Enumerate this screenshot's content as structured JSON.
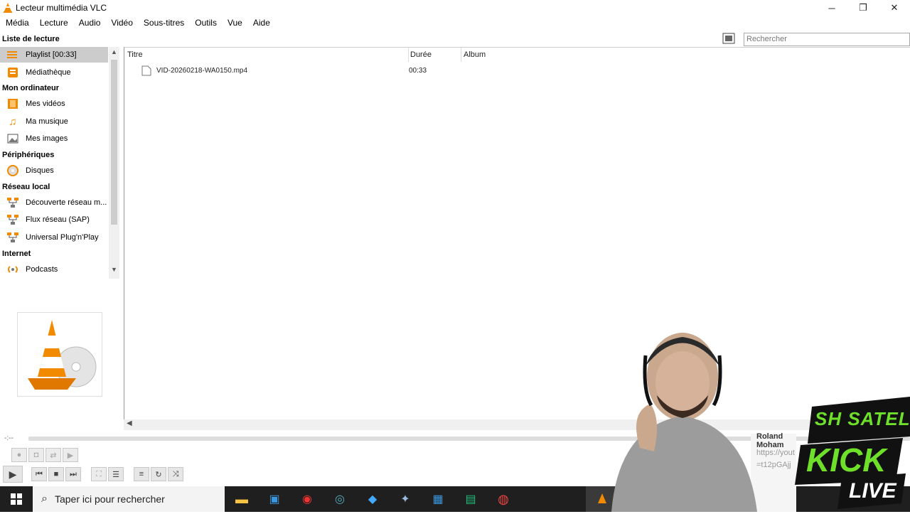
{
  "window": {
    "title": "Lecteur multimédia VLC",
    "minimize": "─",
    "maximize": "❐",
    "close": "✕"
  },
  "menu": [
    "Média",
    "Lecture",
    "Audio",
    "Vidéo",
    "Sous-titres",
    "Outils",
    "Vue",
    "Aide"
  ],
  "sidebar": {
    "sections": [
      {
        "header": "Liste de lecture",
        "items": [
          {
            "label": "Playlist [00:33]",
            "icon": "playlist-icon",
            "selected": true
          },
          {
            "label": "Médiathèque",
            "icon": "library-icon"
          }
        ]
      },
      {
        "header": "Mon ordinateur",
        "items": [
          {
            "label": "Mes vidéos",
            "icon": "videos-icon"
          },
          {
            "label": "Ma musique",
            "icon": "music-icon"
          },
          {
            "label": "Mes images",
            "icon": "images-icon"
          }
        ]
      },
      {
        "header": "Périphériques",
        "items": [
          {
            "label": "Disques",
            "icon": "disc-icon"
          }
        ]
      },
      {
        "header": "Réseau local",
        "items": [
          {
            "label": "Découverte réseau m...",
            "icon": "network-icon"
          },
          {
            "label": "Flux réseau (SAP)",
            "icon": "network-icon"
          },
          {
            "label": "Universal Plug'n'Play",
            "icon": "network-icon"
          }
        ]
      },
      {
        "header": "Internet",
        "items": [
          {
            "label": "Podcasts",
            "icon": "podcast-icon"
          }
        ]
      }
    ]
  },
  "search": {
    "placeholder": "Rechercher"
  },
  "playlist": {
    "columns": [
      "Titre",
      "Durée",
      "Album"
    ],
    "rows": [
      {
        "title": "VID-20260218-WA0150.mp4",
        "duration": "00:33",
        "album": ""
      }
    ]
  },
  "player": {
    "time": "-:--"
  },
  "taskbar": {
    "search_placeholder": "Taper ici pour rechercher"
  },
  "overlay": {
    "text1": "Roland Moham",
    "text2": "https://yout",
    "text3": "=t12pGAjj",
    "logo1": "SH SATELLITE",
    "logo2": "KICK",
    "logo3": "LIVE"
  },
  "colors": {
    "vlc_orange": "#f28a00",
    "selected": "#cccccc",
    "taskbar": "#1f1f1f"
  }
}
